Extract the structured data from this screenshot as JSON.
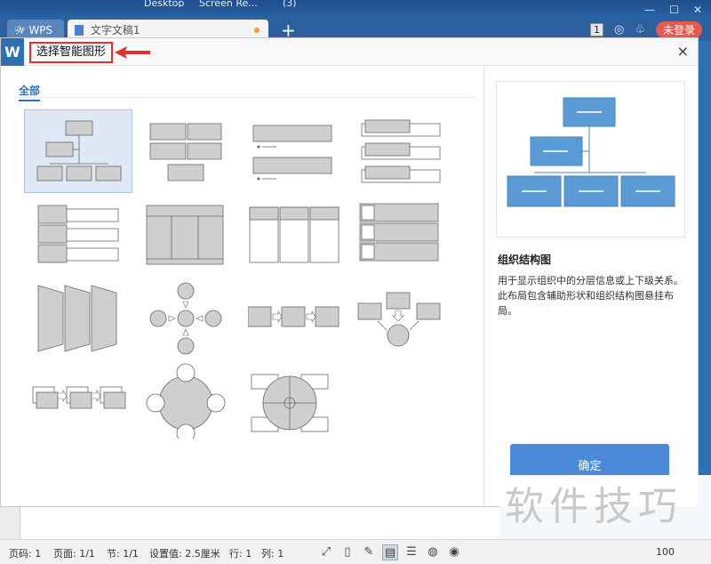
{
  "desktop": {
    "items": [
      "Desktop",
      "Screen Re...",
      "(3)"
    ]
  },
  "tabbar": {
    "wps_label": "WPS",
    "doc_tab_label": "文字文稿1",
    "plus": "+",
    "badge": "1",
    "login": "未登录"
  },
  "dialog": {
    "logo": "W",
    "title": "选择智能图形",
    "close": "×",
    "category_tab": "全部",
    "selected_index": 0,
    "thumbnails": [
      "org-chart",
      "block-grid",
      "bar-list",
      "tag-list",
      "side-list",
      "column-table",
      "card-columns",
      "checklist",
      "trapezoid-columns",
      "cross-circles",
      "arrow-process",
      "merge-arrows",
      "step-cards",
      "center-circle",
      "cycle-center"
    ],
    "preview": {
      "name": "组织结构图",
      "description": "用于显示组织中的分层信息或上下级关系。此布局包含辅助形状和组织结构图悬挂布局。",
      "confirm": "确定"
    }
  },
  "statusbar": {
    "page_code": "页码: 1",
    "page": "页面: 1/1",
    "section": "节: 1/1",
    "setting": "设置值: 2.5厘米",
    "row": "行: 1",
    "col": "列: 1",
    "zoom": "100"
  },
  "watermark": "软件技巧",
  "colors": {
    "accent": "#2f6fb4",
    "diagram_blue": "#5b9bd5",
    "red_highlight": "#dd3333",
    "confirm_button": "#4a8ad6"
  }
}
